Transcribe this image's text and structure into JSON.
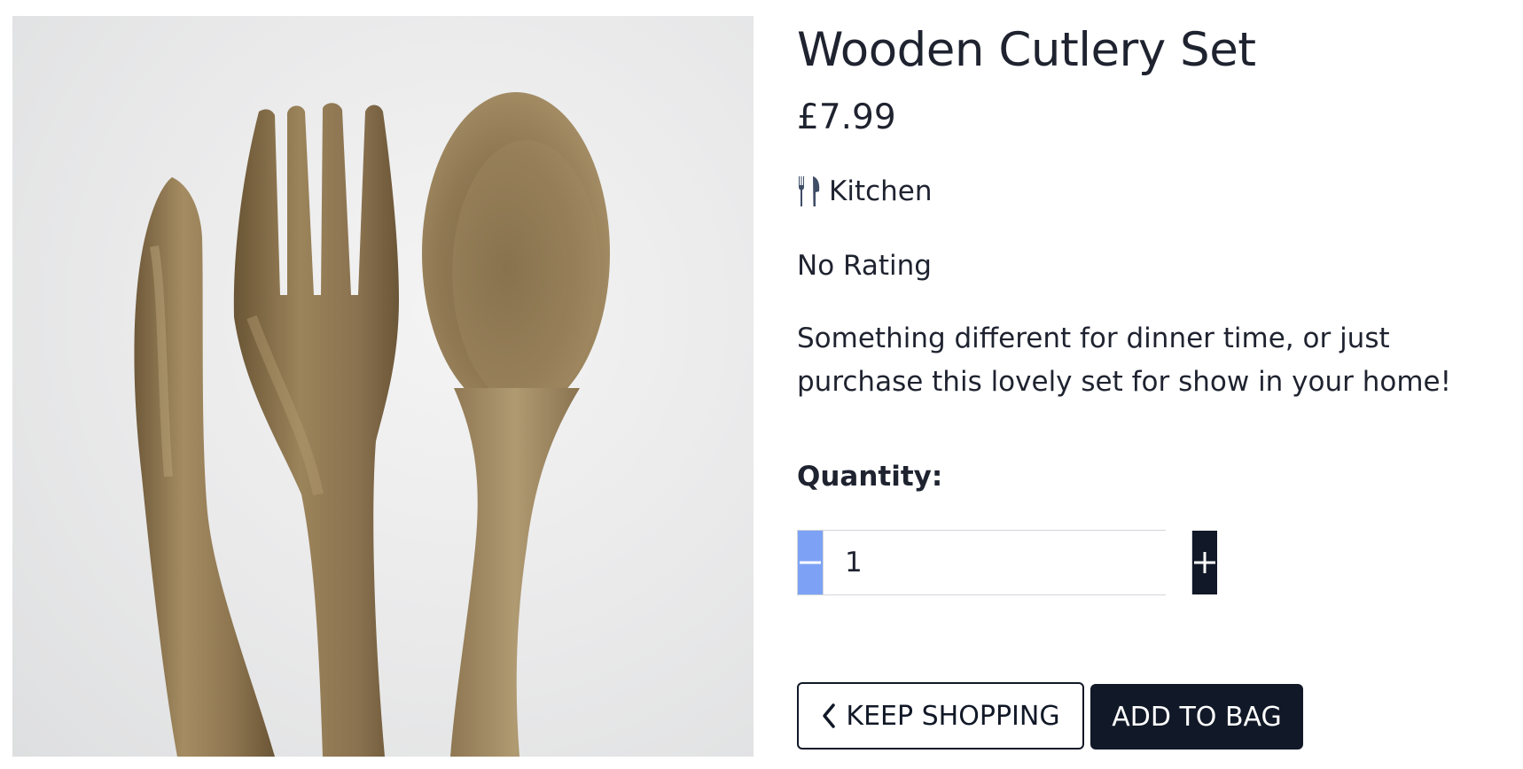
{
  "product": {
    "title": "Wooden Cutlery Set",
    "price": "£7.99",
    "category": {
      "icon": "utensils-icon",
      "label": "Kitchen"
    },
    "rating": "No Rating",
    "description": "Something different for dinner time, or just purchase this lovely set for show in your home!",
    "image": {
      "depicts": [
        "knife",
        "fork",
        "spoon"
      ]
    }
  },
  "quantity": {
    "label": "Quantity:",
    "value": "1",
    "decrement_icon": "minus-icon",
    "increment_icon": "plus-icon"
  },
  "actions": {
    "keep_shopping_label": "KEEP SHOPPING",
    "keep_shopping_icon": "chevron-left-icon",
    "add_to_bag_label": "ADD TO BAG"
  },
  "colors": {
    "text": "#1f2330",
    "dark": "#111827",
    "decrement_bg": "#7da2f5",
    "icon_blue_gray": "#3f4d66",
    "wood": "#8b7450"
  }
}
